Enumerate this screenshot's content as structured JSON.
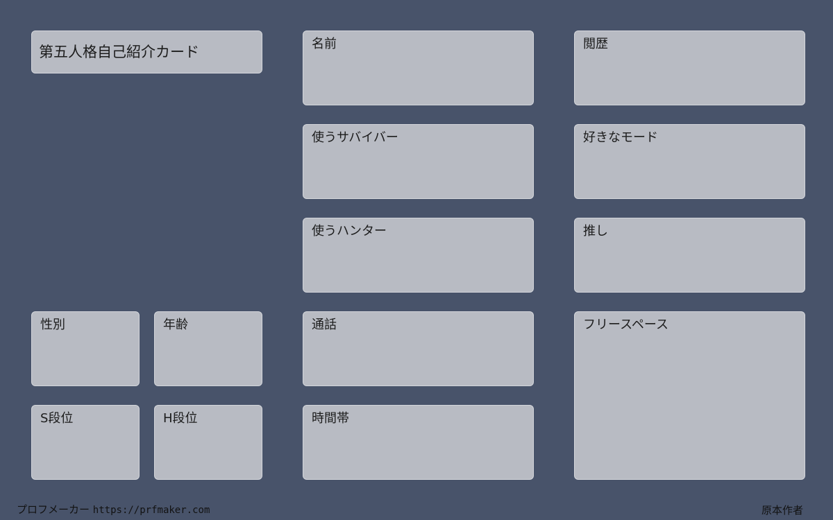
{
  "title": "第五人格自己紹介カード",
  "fields": {
    "name": "名前",
    "history": "閲歴",
    "survivor": "使うサバイバー",
    "favorite_mode": "好きなモード",
    "hunter": "使うハンター",
    "oshi": "推し",
    "gender": "性別",
    "age": "年齢",
    "voice_chat": "通話",
    "free_space": "フリースペース",
    "s_rank": "S段位",
    "h_rank": "H段位",
    "time_slot": "時間帯"
  },
  "footer": {
    "brand": "プロフメーカー",
    "url": "https://prfmaker.com",
    "credit": "原本作者"
  },
  "colors": {
    "background": "#48536a",
    "box": "#b8bbc3",
    "box_border": "#d4d6db"
  }
}
